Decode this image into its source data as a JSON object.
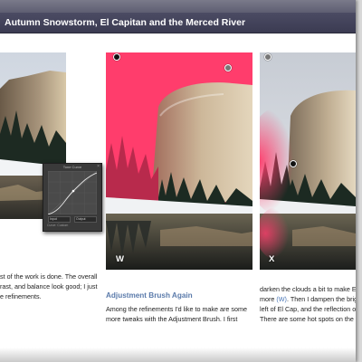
{
  "header": {
    "title": "Autumn Snowstorm, El Capitan and the Merced River"
  },
  "photos": {
    "middle_label": "W",
    "right_label": "X"
  },
  "curve_panel": {
    "title": "Tone Curve",
    "input_value": "Input",
    "output_value": "Output",
    "footer": "Curve: Custom"
  },
  "columns": {
    "left": {
      "lines": [
        "st of the work is done. The overall",
        "rast, and balance look good; I just",
        "e refinements."
      ]
    },
    "middle": {
      "heading": "Adjustment Brush Again",
      "lines": [
        "Among the refinements I'd like to make are some",
        "more tweaks with the Adjustment Brush. I first"
      ]
    },
    "right": {
      "line1": "darken the clouds a bit to make El C",
      "line2_pre": "more ",
      "line2_ref": "(W)",
      "line2_post": ". Then I dampen the brigh",
      "line3": "left of El Cap, and the reflection of t",
      "line4": "There are some hot spots on the roc"
    }
  },
  "colors": {
    "header_bg": "#3b3b52",
    "heading_blue": "#5b7bab",
    "mask_pink": "#ff3a6a"
  }
}
